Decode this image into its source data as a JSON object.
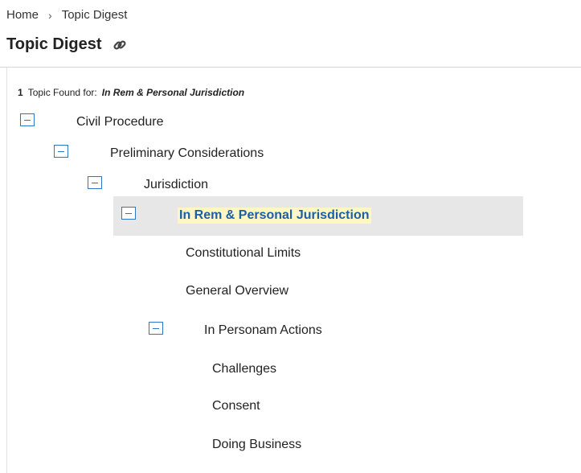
{
  "breadcrumb": {
    "home": "Home",
    "separator": "›",
    "current": "Topic Digest"
  },
  "header": {
    "title": "Topic Digest",
    "link_icon": "paperclip-link-icon"
  },
  "results": {
    "count": "1",
    "label": "Topic Found for:",
    "query": "In Rem & Personal Jurisdiction"
  },
  "tree": {
    "civil_procedure": "Civil Procedure",
    "preliminary_considerations": "Preliminary Considerations",
    "jurisdiction": "Jurisdiction",
    "in_rem": "In Rem & Personal Jurisdiction",
    "constitutional_limits": "Constitutional Limits",
    "general_overview": "General Overview",
    "in_personam": "In Personam Actions",
    "challenges": "Challenges",
    "consent": "Consent",
    "doing_business": "Doing Business"
  },
  "colors": {
    "accent": "#2a78c7",
    "selected_text": "#1b5fa8",
    "highlight": "#fff6c6",
    "selected_row": "#e7e7e7"
  }
}
